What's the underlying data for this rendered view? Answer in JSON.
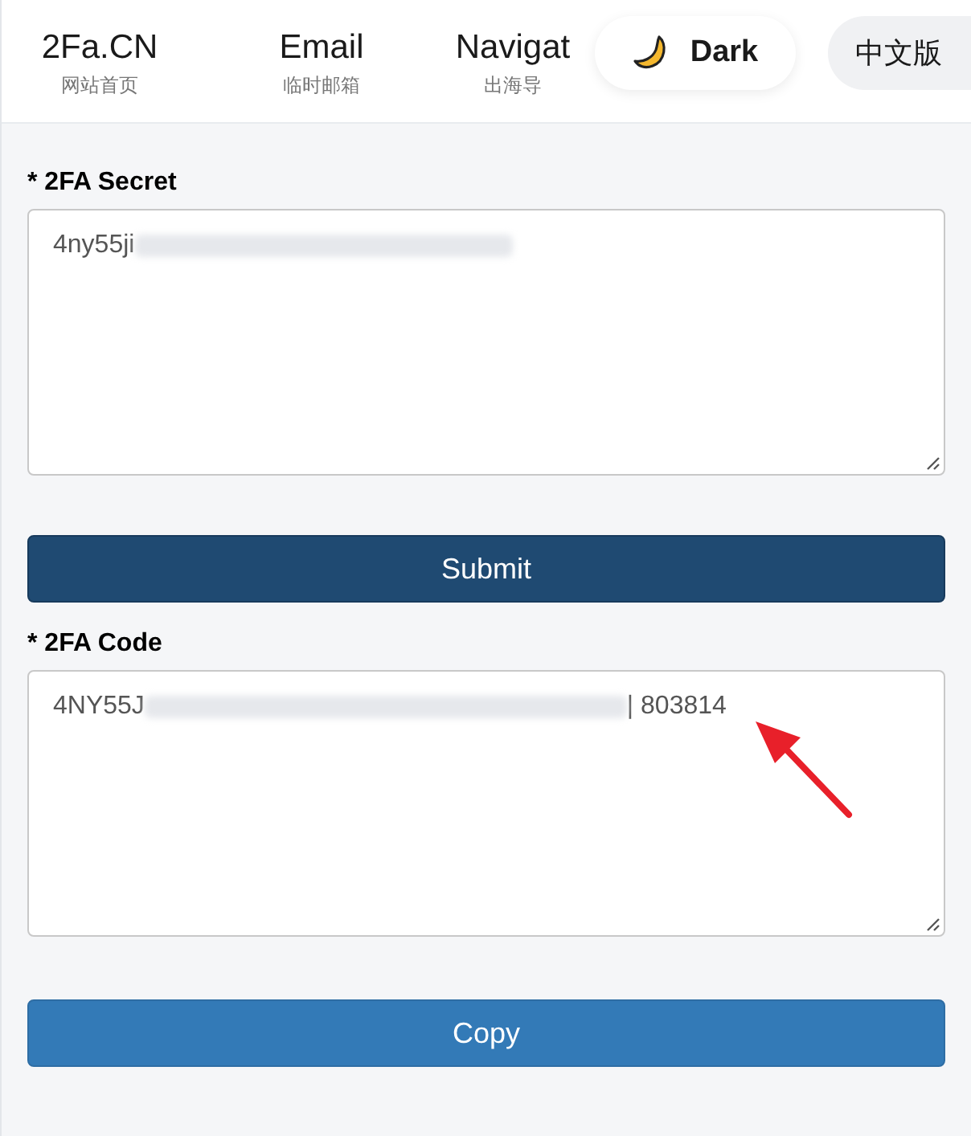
{
  "nav": {
    "items": [
      {
        "title": "2Fa.CN",
        "subtitle": "网站首页"
      },
      {
        "title": "Email",
        "subtitle": "临时邮箱"
      },
      {
        "title": "Navigat",
        "subtitle": "出海导"
      }
    ],
    "theme_button": {
      "label": "Dark"
    },
    "language_button": {
      "label": "中文版"
    }
  },
  "form": {
    "fields": [
      {
        "label": "* 2FA Secret",
        "value_start": "4ny55ji",
        "redacted": true
      },
      {
        "label": "* 2FA Code",
        "value_start": "4NY55J",
        "value_end": "| 803814",
        "redacted": true,
        "annotated": true
      }
    ],
    "buttons": [
      {
        "label": "Submit",
        "kind": "primary"
      },
      {
        "label": "Copy",
        "kind": "secondary"
      }
    ]
  }
}
